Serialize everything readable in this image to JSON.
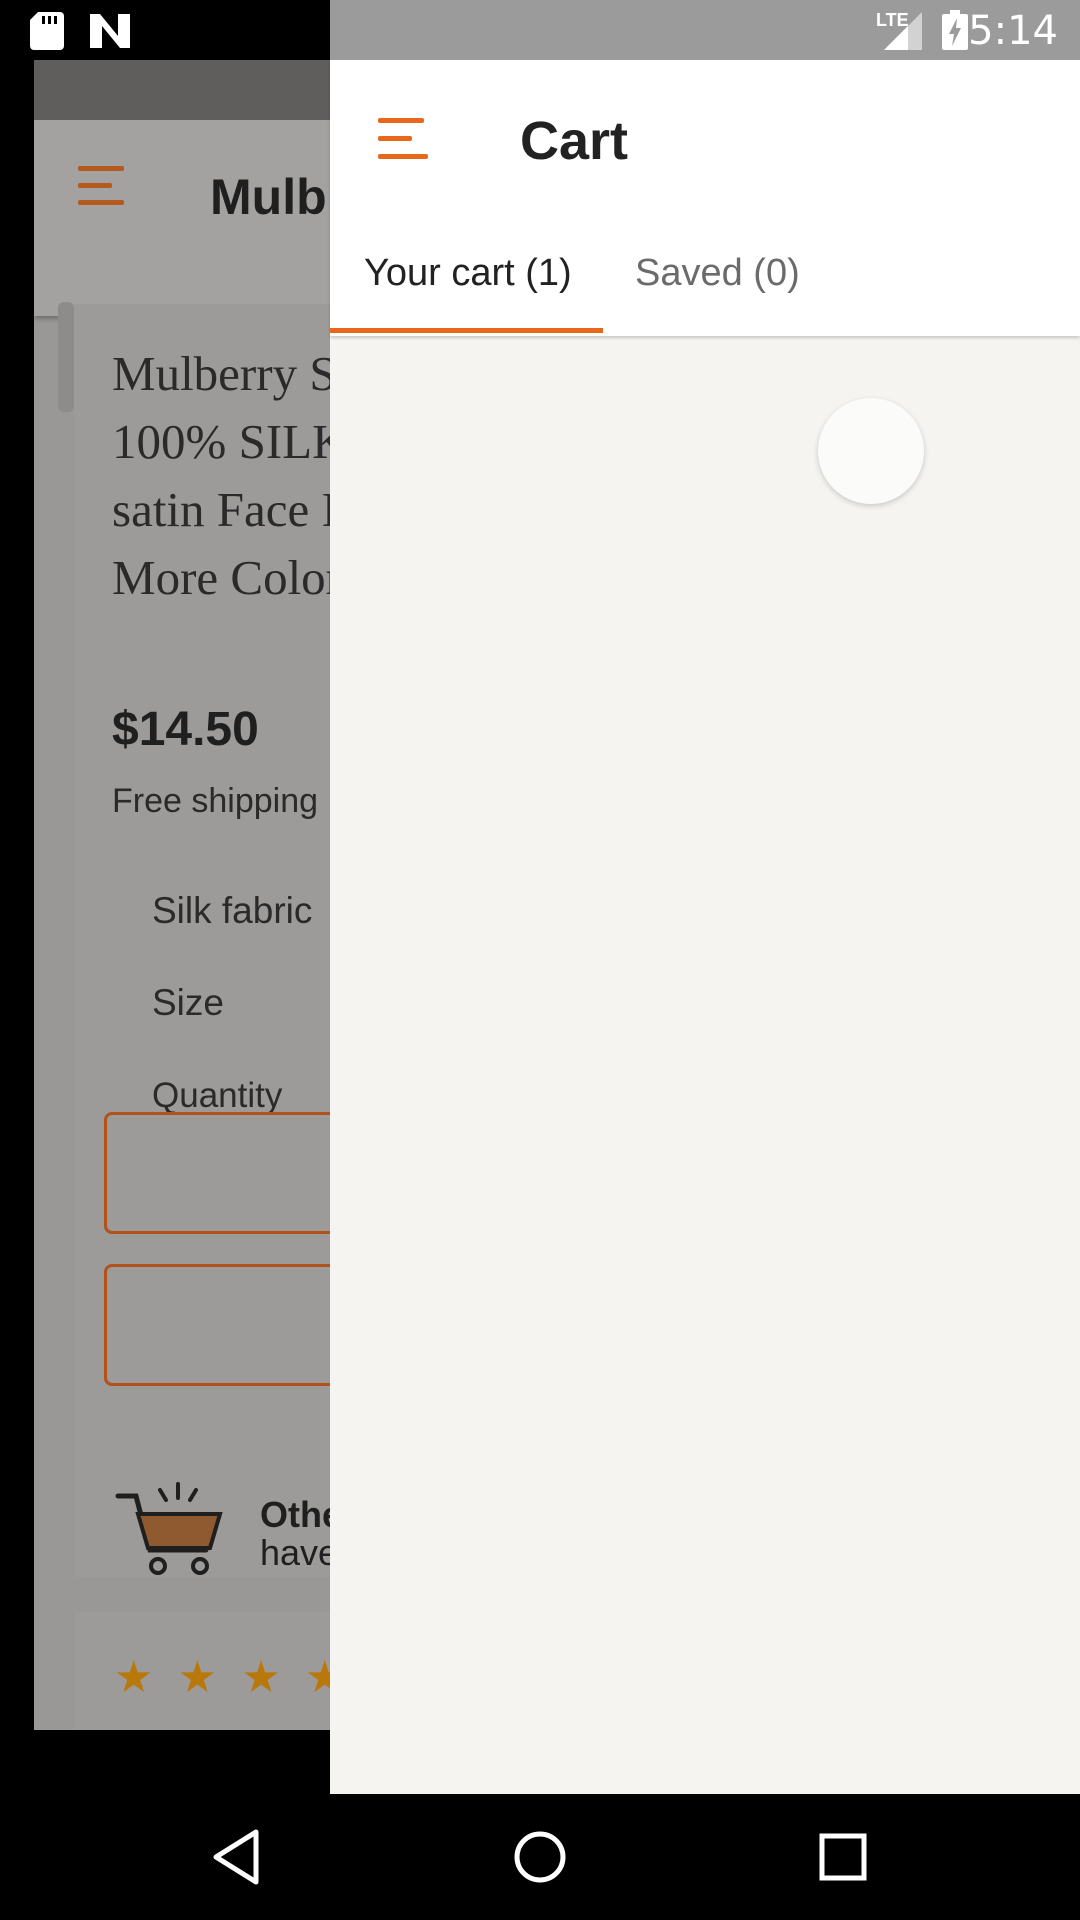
{
  "status_bar": {
    "time": "5:14",
    "network": "LTE",
    "icons": [
      "sd-card-icon",
      "n-logo-icon",
      "lte-signal-icon",
      "battery-charging-icon"
    ]
  },
  "background_page": {
    "app_title": "Mulb",
    "product_title_lines": [
      "Mulberry S",
      "100% SILK",
      "satin Face I",
      "More Color"
    ],
    "price": "$14.50",
    "shipping": "Free shipping",
    "options": [
      "Silk fabric",
      "Size",
      "Quantity"
    ],
    "other_line1": "Othe",
    "other_line2": "have",
    "stars": "★ ★ ★ ★ ★"
  },
  "cart": {
    "title": "Cart",
    "tabs": [
      {
        "label": "Your cart (1)",
        "selected": true
      },
      {
        "label": "Saved (0)",
        "selected": false
      }
    ],
    "loading": true
  },
  "colors": {
    "accent": "#e8671a",
    "drawer_bg": "#f5f4f1",
    "scrim": "#9a9896"
  },
  "nav_bar": {
    "icons": [
      "back-icon",
      "home-icon",
      "recents-icon"
    ]
  }
}
